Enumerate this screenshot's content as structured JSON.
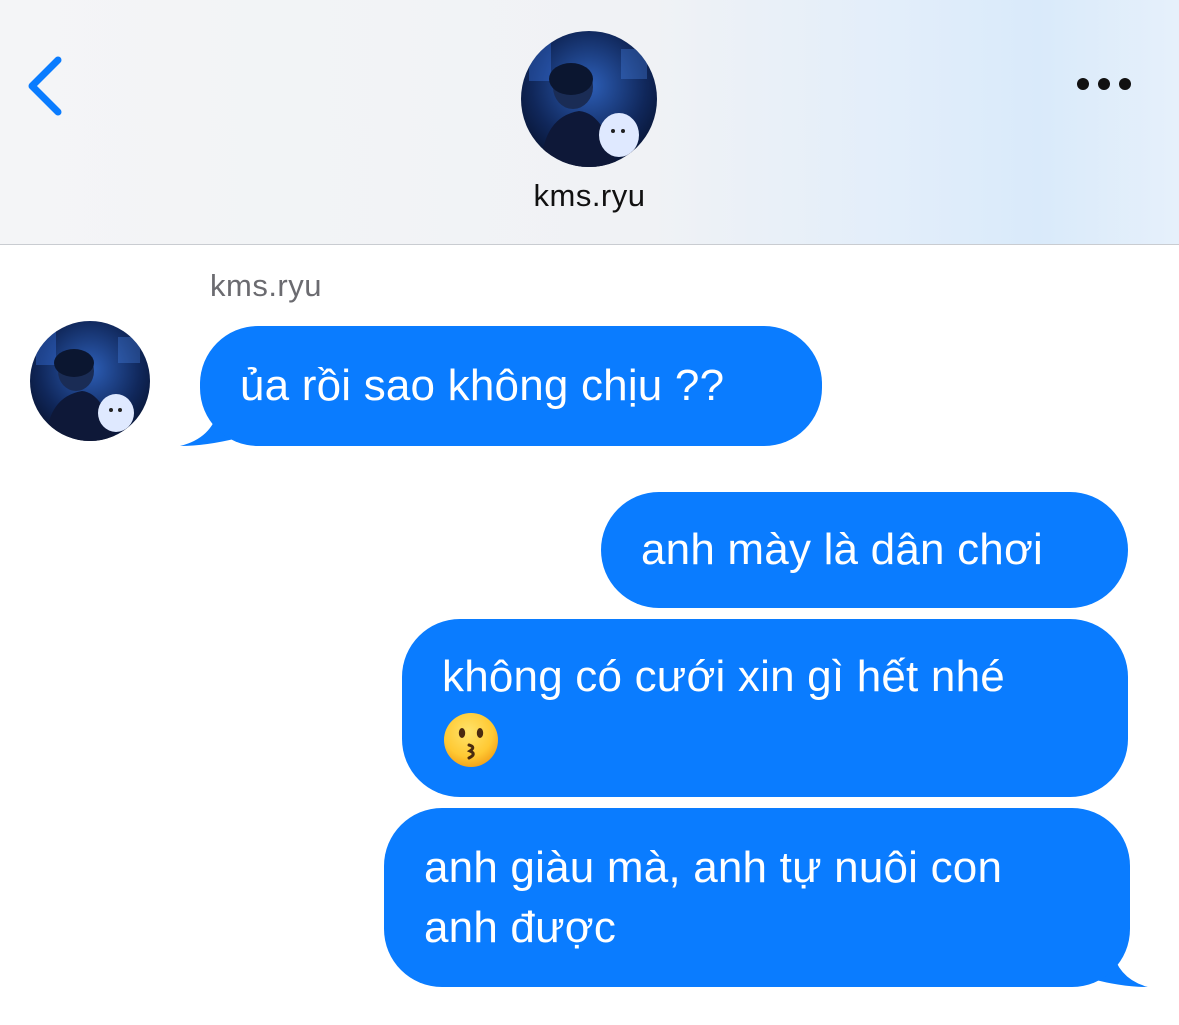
{
  "header": {
    "contact_name": "kms.ryu",
    "back_icon": "chevron-left-icon",
    "more_icon": "more-horizontal-icon"
  },
  "thread": {
    "sender_label": "kms.ryu",
    "messages": [
      {
        "direction": "incoming",
        "text": "ủa rồi sao không chịu ??"
      },
      {
        "direction": "outgoing",
        "text": "anh mày là dân chơi"
      },
      {
        "direction": "outgoing",
        "text": "không có cưới xin gì hết nhé",
        "emoji": "kissing-face-icon"
      },
      {
        "direction": "outgoing",
        "line1": "anh giàu mà, anh tự nuôi con",
        "line2": "anh được"
      }
    ]
  },
  "colors": {
    "bubble": "#0a7cff",
    "accent": "#0a7cff",
    "text_dark": "#111111",
    "text_muted": "#6b6b70"
  }
}
